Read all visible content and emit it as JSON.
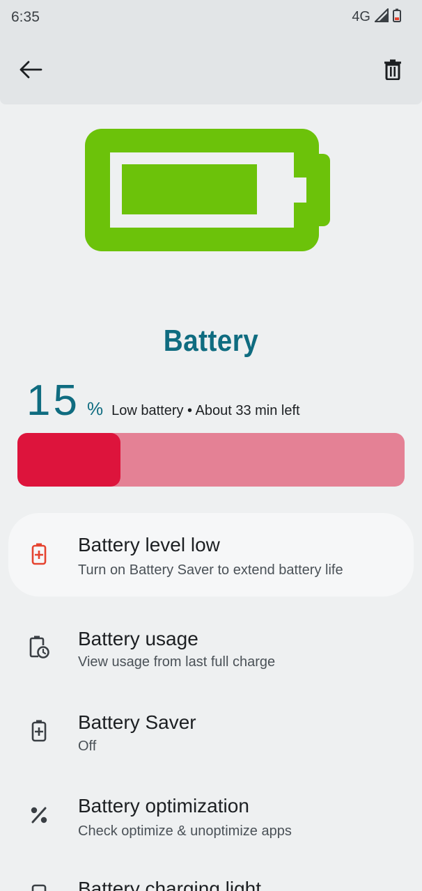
{
  "status_bar": {
    "time": "6:35",
    "network": "4G",
    "icons": [
      "signal-icon",
      "battery-low-icon"
    ]
  },
  "app_bar": {
    "back_icon": "arrow-back-icon",
    "delete_icon": "trash-icon"
  },
  "hero": {
    "icon": "battery-icon",
    "color": "#6cc20a"
  },
  "title": "Battery",
  "level": {
    "value": "15",
    "unit": "%",
    "status": "Low battery • About 33 min left",
    "percent": 15,
    "fill_color": "#dd143c",
    "track_color": "#e48195"
  },
  "items": [
    {
      "icon": "battery-alert-icon",
      "title": "Battery level low",
      "subtitle": "Turn on Battery Saver to extend battery life"
    },
    {
      "icon": "battery-usage-icon",
      "title": "Battery usage",
      "subtitle": "View usage from last full charge"
    },
    {
      "icon": "battery-saver-icon",
      "title": "Battery Saver",
      "subtitle": "Off"
    },
    {
      "icon": "percent-icon",
      "title": "Battery optimization",
      "subtitle": "Check optimize & unoptimize apps"
    },
    {
      "icon": "charging-light-icon",
      "title": "Battery charging light",
      "subtitle": ""
    }
  ]
}
